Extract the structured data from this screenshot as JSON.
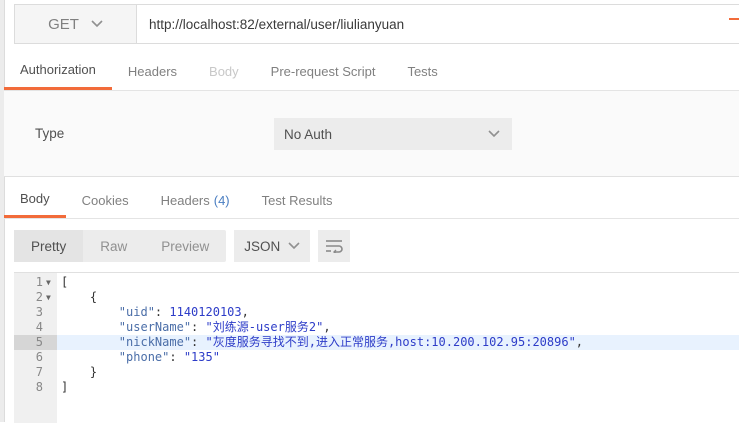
{
  "request": {
    "method": "GET",
    "url": "http://localhost:82/external/user/liulianyuan"
  },
  "request_tabs": [
    {
      "label": "Authorization",
      "state": "active"
    },
    {
      "label": "Headers",
      "state": "normal"
    },
    {
      "label": "Body",
      "state": "disabled"
    },
    {
      "label": "Pre-request Script",
      "state": "normal"
    },
    {
      "label": "Tests",
      "state": "normal"
    }
  ],
  "auth": {
    "type_label": "Type",
    "type_value": "No Auth"
  },
  "response_tabs": {
    "body": "Body",
    "cookies": "Cookies",
    "headers": "Headers",
    "headers_count": "(4)",
    "test_results": "Test Results"
  },
  "view": {
    "pretty": "Pretty",
    "raw": "Raw",
    "preview": "Preview",
    "format": "JSON"
  },
  "code_lines": [
    {
      "n": "1",
      "text": "["
    },
    {
      "n": "2",
      "text": "    {"
    },
    {
      "n": "3",
      "key": "\"uid\"",
      "value": "1140120103",
      "end": ","
    },
    {
      "n": "4",
      "key": "\"userName\"",
      "value": "\"刘练源-user服务2\"",
      "end": ","
    },
    {
      "n": "5",
      "key": "\"nickName\"",
      "value": "\"灰度服务寻找不到,进入正常服务,host:10.200.102.95:20896\"",
      "end": ","
    },
    {
      "n": "6",
      "key": "\"phone\"",
      "value": "\"135\"",
      "end": ""
    },
    {
      "n": "7",
      "text": "    }"
    },
    {
      "n": "8",
      "text": "]"
    }
  ],
  "colors": {
    "accent": "#f26b3a",
    "count_blue": "#4a7ec2",
    "highlight_line": "#e8f2fe"
  }
}
